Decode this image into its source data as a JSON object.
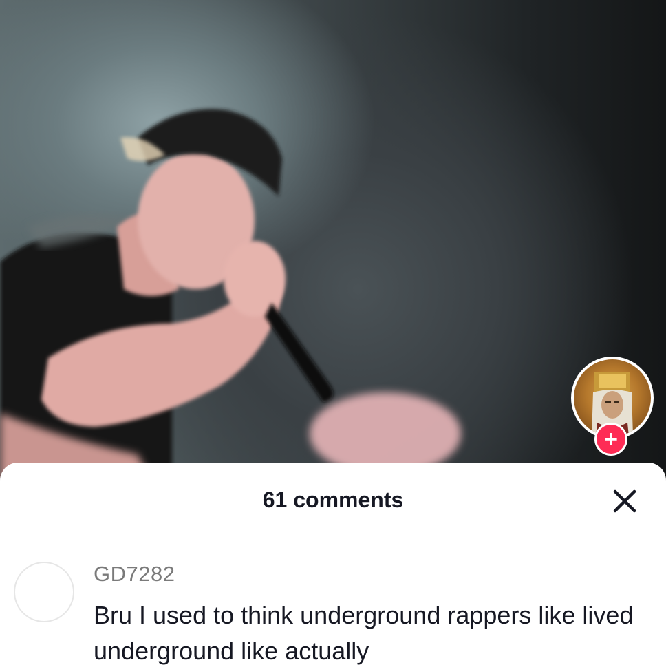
{
  "video": {
    "icon": "performer-video-frame"
  },
  "creator": {
    "avatar_icon": "creator-avatar-icon",
    "follow_label": "+"
  },
  "comments_sheet": {
    "title": "61 comments",
    "close_icon": "close-icon",
    "comments": [
      {
        "username": "GD7282",
        "text": "Bru I used to think underground rappers like lived underground like actually"
      }
    ]
  },
  "colors": {
    "follow_button": "#fe2c55",
    "text_primary": "#161823",
    "text_secondary": "#7a7a7a"
  }
}
